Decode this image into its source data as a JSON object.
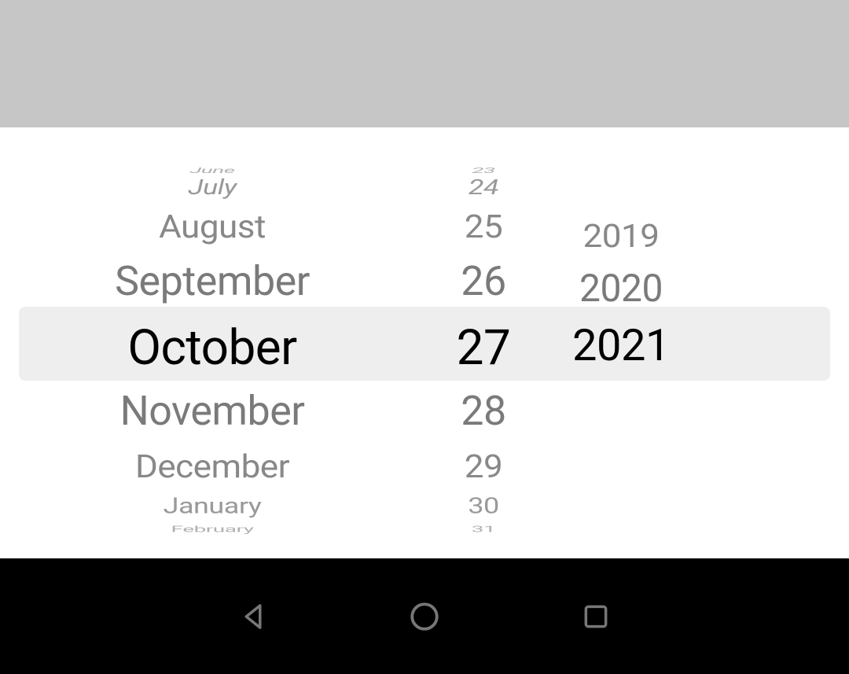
{
  "picker": {
    "month": {
      "selected": "October",
      "items_above": [
        "June",
        "July",
        "August",
        "September"
      ],
      "items_below": [
        "November",
        "December",
        "January",
        "February"
      ]
    },
    "day": {
      "selected": "27",
      "items_above": [
        "23",
        "24",
        "25",
        "26"
      ],
      "items_below": [
        "28",
        "29",
        "30",
        "31"
      ]
    },
    "year": {
      "selected": "2021",
      "items_above": [
        "2019",
        "2020"
      ],
      "items_below": []
    }
  },
  "nav": {
    "back": "back",
    "home": "home",
    "recent": "recent"
  }
}
